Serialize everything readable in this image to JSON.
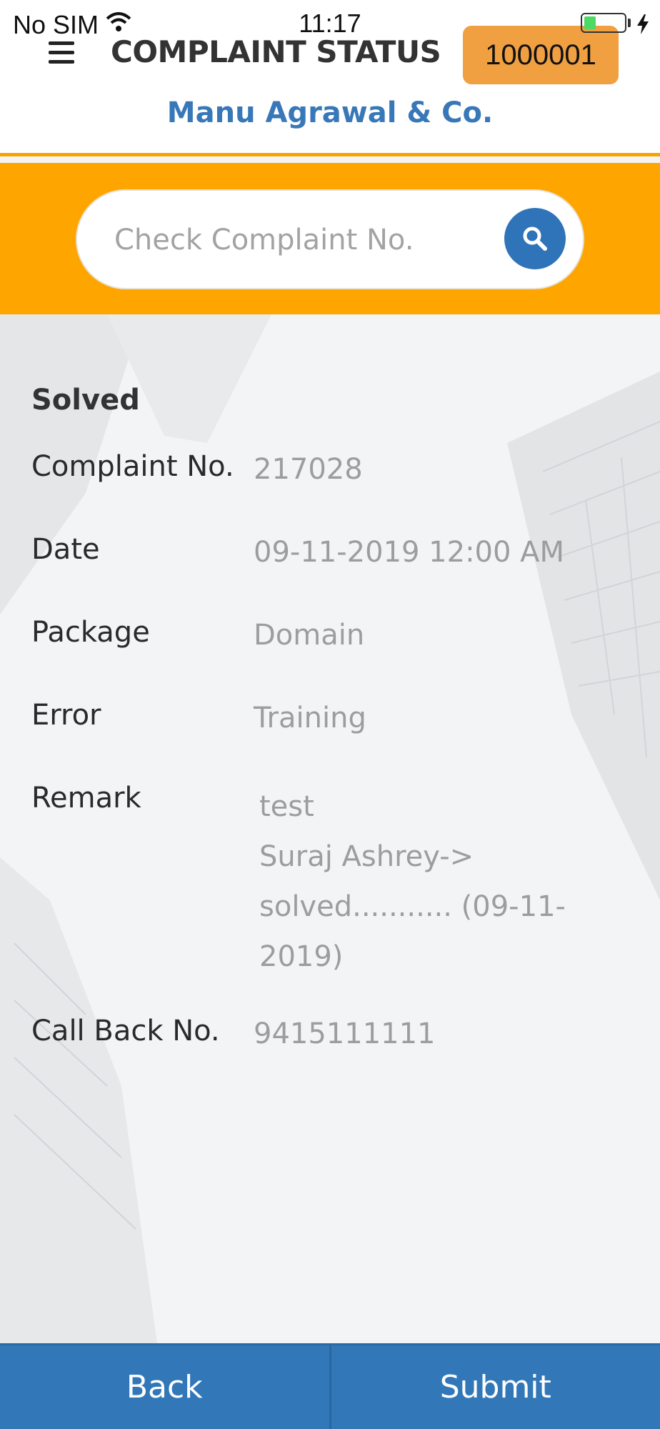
{
  "status_bar": {
    "carrier": "No SIM",
    "time": "11:17",
    "battery_level": 0.3,
    "icons": [
      "wifi-icon",
      "battery-icon",
      "charging-icon"
    ]
  },
  "header": {
    "menu_icon": "hamburger-menu-icon",
    "title": "COMPLAINT STATUS",
    "client_id": "1000001",
    "company": "Manu Agrawal & Co."
  },
  "search": {
    "placeholder": "Check Complaint No.",
    "value": "",
    "icon": "search-icon"
  },
  "complaint": {
    "status": "Solved",
    "fields": [
      {
        "label": "Complaint No.",
        "value": "217028"
      },
      {
        "label": "Date",
        "value": "09-11-2019 12:00 AM"
      },
      {
        "label": "Package",
        "value": "Domain"
      },
      {
        "label": "Error",
        "value": "Training"
      }
    ],
    "remark": {
      "label": "Remark",
      "lines": [
        "test",
        "Suraj Ashrey->",
        "solved........... (09-11-",
        "2019)"
      ]
    },
    "callback": {
      "label": "Call Back No.",
      "value": "9415111111"
    }
  },
  "footer": {
    "back_label": "Back",
    "submit_label": "Submit"
  },
  "colors": {
    "accent_orange": "#fea500",
    "badge_orange": "#f0a040",
    "brand_blue": "#3278b9",
    "company_blue": "#3878b8"
  }
}
